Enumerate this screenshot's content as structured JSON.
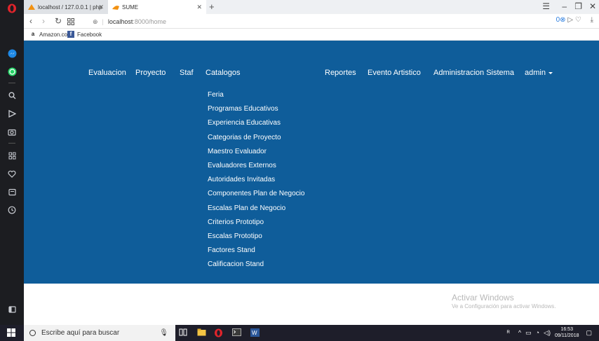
{
  "browser": {
    "tabs": [
      {
        "label": "localhost / 127.0.0.1 | php"
      },
      {
        "label": "SUME"
      }
    ],
    "url_host": "localhost",
    "url_path": ":8000/home",
    "bookmarks": [
      "Amazon.com",
      "Facebook"
    ]
  },
  "nav": {
    "items": [
      "Evaluacion",
      "Proyecto",
      "Staf",
      "Catalogos",
      "Reportes",
      "Evento Artistico",
      "Administracion Sistema"
    ],
    "user": "admin"
  },
  "dropdown": {
    "items": [
      "Feria",
      "Programas Educativos",
      "Experiencia Educativas",
      "Categorias de Proyecto",
      "Maestro Evaluador",
      "Evaluadores Externos",
      "Autoridades Invitadas",
      "Componentes Plan de Negocio",
      "Escalas Plan de Negocio",
      "Criterios Prototipo",
      "Escalas Prototipo",
      "Factores Stand",
      "Calificacion Stand"
    ]
  },
  "watermark": {
    "title": "Activar Windows",
    "subtitle": "Ve a Configuración para activar Windows."
  },
  "taskbar": {
    "search_placeholder": "Escribe aquí para buscar",
    "time": "16:53",
    "date": "09/11/2018"
  },
  "colors": {
    "navbar": "#0f5d9a",
    "sidebar": "#1c1d21",
    "taskbar": "#1e1e2a"
  }
}
